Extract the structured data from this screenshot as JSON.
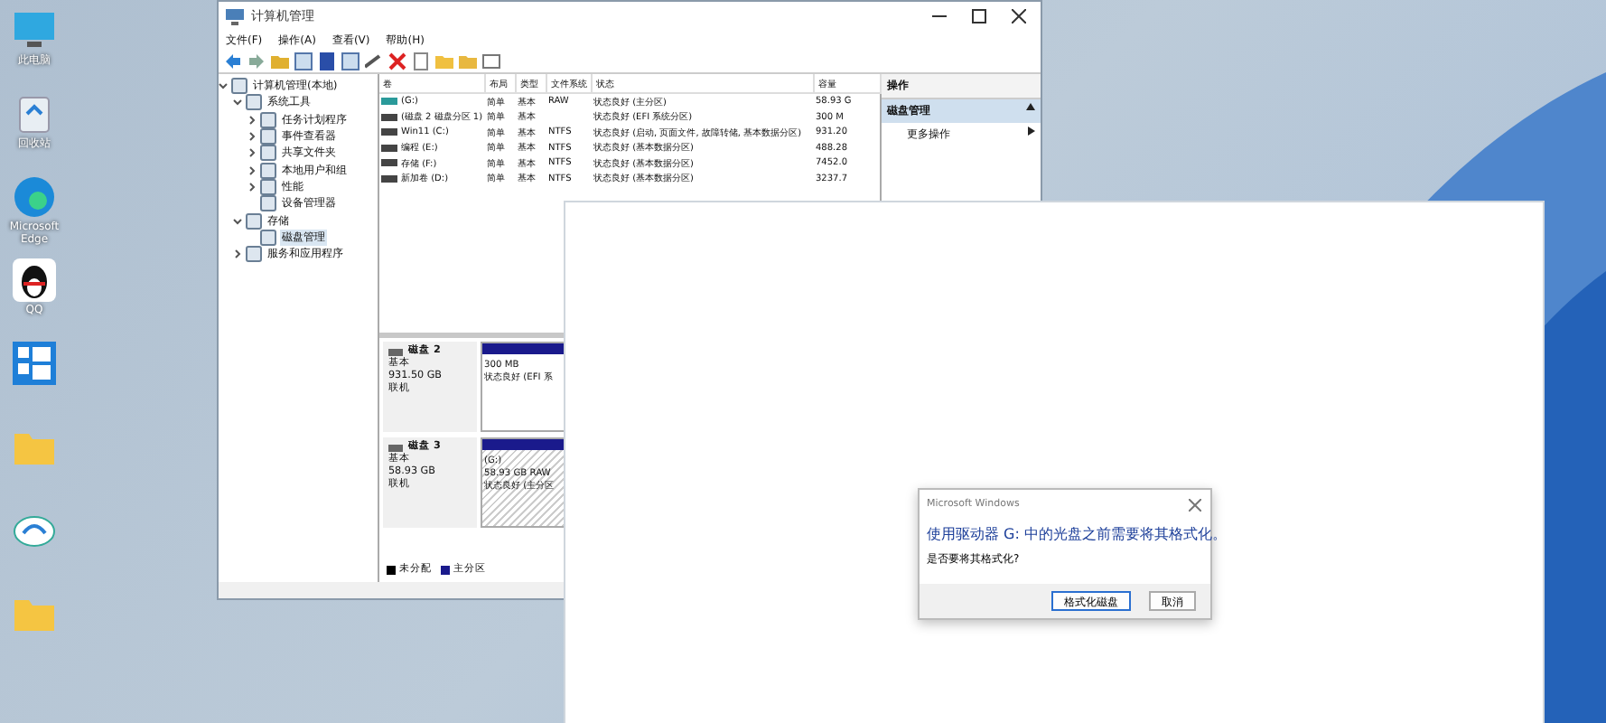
{
  "desktop_icons": [
    {
      "label": "此电脑",
      "kind": "monitor"
    },
    {
      "label": "回收站",
      "kind": "bin"
    },
    {
      "label": "Microsoft Edge",
      "kind": "edge"
    },
    {
      "label": "QQ",
      "kind": "qq"
    },
    {
      "kind": "tiles"
    },
    {
      "kind": "folder"
    },
    {
      "kind": "cloud"
    },
    {
      "kind": "folder"
    }
  ],
  "window": {
    "title": "计算机管理",
    "menu": [
      "文件(F)",
      "操作(A)",
      "查看(V)",
      "帮助(H)"
    ],
    "tree": [
      {
        "label": "计算机管理(本地)",
        "expanded": true,
        "selected": false,
        "children": [
          {
            "label": "系统工具",
            "expanded": true,
            "selected": false,
            "children": [
              {
                "label": "任务计划程序",
                "expanded": false,
                "selected": false
              },
              {
                "label": "事件查看器",
                "expanded": false,
                "selected": false
              },
              {
                "label": "共享文件夹",
                "expanded": false,
                "selected": false
              },
              {
                "label": "本地用户和组",
                "expanded": false,
                "selected": false
              },
              {
                "label": "性能",
                "expanded": false,
                "selected": false
              },
              {
                "label": "设备管理器",
                "selected": false
              }
            ]
          },
          {
            "label": "存储",
            "expanded": true,
            "selected": false,
            "children": [
              {
                "label": "磁盘管理",
                "selected": true
              }
            ]
          },
          {
            "label": "服务和应用程序",
            "expanded": false,
            "selected": false
          }
        ]
      }
    ],
    "volumes": {
      "columns": [
        "卷",
        "布局",
        "类型",
        "文件系统",
        "状态",
        "容量"
      ],
      "rows": [
        [
          "(G:)",
          "简单",
          "基本",
          "RAW",
          "状态良好 (主分区)",
          "58.93 G"
        ],
        [
          "(磁盘 2 磁盘分区 1)",
          "简单",
          "基本",
          "",
          "状态良好 (EFI 系统分区)",
          "300 M"
        ],
        [
          "Win11 (C:)",
          "简单",
          "基本",
          "NTFS",
          "状态良好 (启动, 页面文件, 故障转储, 基本数据分区)",
          "931.20"
        ],
        [
          "编程 (E:)",
          "简单",
          "基本",
          "NTFS",
          "状态良好 (基本数据分区)",
          "488.28"
        ],
        [
          "存储 (F:)",
          "简单",
          "基本",
          "NTFS",
          "状态良好 (基本数据分区)",
          "7452.0"
        ],
        [
          "新加卷 (D:)",
          "简单",
          "基本",
          "NTFS",
          "状态良好 (基本数据分区)",
          "3237.7"
        ]
      ]
    },
    "disks": [
      {
        "name": "磁盘 2",
        "type": "基本",
        "size": "931.50 GB",
        "status": "联机",
        "partition": {
          "lines": [
            "300 MB",
            "状态良好 (EFI 系"
          ],
          "selected": false
        }
      },
      {
        "name": "磁盘 3",
        "type": "基本",
        "size": "58.93 GB",
        "status": "联机",
        "partition": {
          "lines": [
            "(G:)",
            "58.93 GB RAW",
            "状态良好 (主分区"
          ],
          "selected": true
        }
      }
    ],
    "legend": [
      {
        "label": "未分配",
        "color": "#000000"
      },
      {
        "label": "主分区",
        "color": "#1a1a8c"
      }
    ],
    "actions": {
      "header": "操作",
      "items": [
        {
          "label": "磁盘管理",
          "kind": "section"
        },
        {
          "label": "更多操作",
          "kind": "submenu"
        }
      ]
    }
  },
  "dialog": {
    "title": "Microsoft Windows",
    "message": "使用驱动器 G: 中的光盘之前需要将其格式化。",
    "question": "是否要将其格式化?",
    "buttons": [
      {
        "label": "格式化磁盘",
        "selected": true
      },
      {
        "label": "取消",
        "selected": false
      }
    ]
  }
}
